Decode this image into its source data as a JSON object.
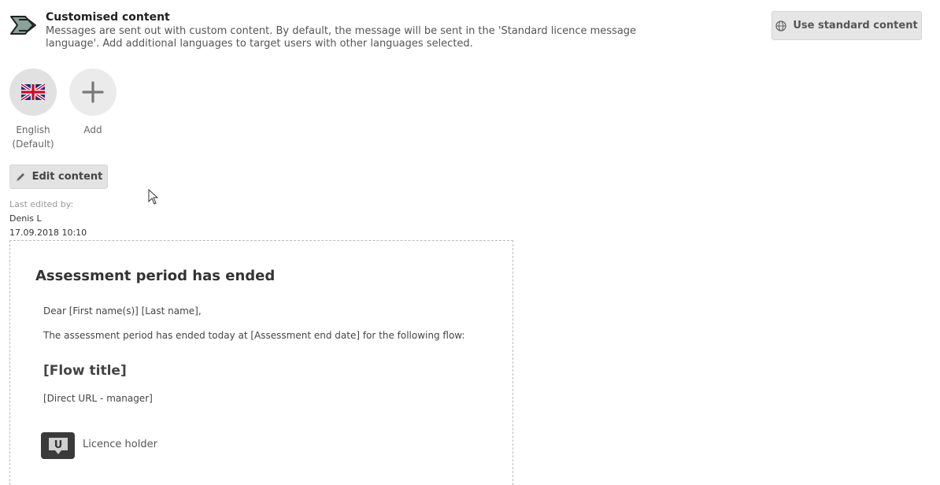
{
  "header": {
    "icon": "flow-arrow-icon",
    "title": "Customised content",
    "description": "Messages are sent out with custom content. By default, the message will be sent in the 'Standard licence message language'. Add additional languages to target users with other languages selected."
  },
  "toolbar": {
    "use_standard_label": "Use standard content",
    "use_standard_icon": "globe-icon",
    "edit_label": "Edit content",
    "edit_icon": "pencil-icon"
  },
  "languages": [
    {
      "label_line1": "English",
      "label_line2": "(Default)",
      "icon": "uk-flag-icon"
    },
    {
      "label_line1": "Add",
      "icon": "plus-icon"
    }
  ],
  "meta": {
    "last_edited_label": "Last edited by:",
    "editor": "Denis L",
    "timestamp": "17.09.2018 10:10"
  },
  "preview": {
    "title": "Assessment period has ended",
    "greeting": "Dear [First name(s)] [Last name],",
    "body": "The assessment period has ended today at [Assessment end date] for the following flow:",
    "flow_title": "[Flow title]",
    "url": "[Direct URL - manager]",
    "logo_icon": "licence-holder-logo-icon",
    "logo_letter": "U",
    "holder": "Licence holder"
  }
}
